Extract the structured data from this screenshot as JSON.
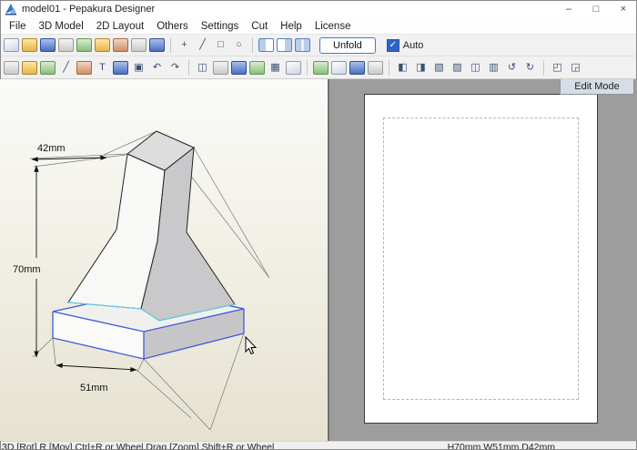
{
  "window": {
    "title": "model01 - Pepakura Designer",
    "controls": {
      "minimize": "–",
      "maximize": "□",
      "close": "×"
    }
  },
  "menu": {
    "items": [
      "File",
      "3D Model",
      "2D Layout",
      "Others",
      "Settings",
      "Cut",
      "Help",
      "License"
    ]
  },
  "toolbar1": {
    "groups": [
      [
        {
          "name": "new-document",
          "style": "ic-a"
        },
        {
          "name": "open-file",
          "style": "ic-b"
        },
        {
          "name": "save-file",
          "style": "ic-c"
        },
        {
          "name": "print",
          "style": "ic-f"
        },
        {
          "name": "texture-settings",
          "style": "ic-d"
        },
        {
          "name": "measure-tool",
          "style": "ic-b"
        },
        {
          "name": "hammer-tool",
          "style": "ic-e"
        },
        {
          "name": "scale-tool",
          "style": "ic-f"
        },
        {
          "name": "link-faces",
          "style": "ic-c"
        }
      ],
      [
        {
          "name": "pick-vertex",
          "glyph": "+"
        },
        {
          "name": "pick-edge",
          "glyph": "╱"
        },
        {
          "name": "pick-face",
          "glyph": "□"
        },
        {
          "name": "pick-object",
          "glyph": "○"
        }
      ],
      [
        {
          "name": "show-3d-window",
          "style": "ic-pane-l"
        },
        {
          "name": "show-2d-window",
          "style": "ic-pane-r"
        },
        {
          "name": "show-both-windows",
          "style": "ic-pane-2"
        }
      ]
    ],
    "unfold_label": "Unfold",
    "auto_label": "Auto",
    "auto_checked": true,
    "check_glyph": "✓"
  },
  "toolbar2": {
    "groups": [
      [
        {
          "name": "move-part",
          "style": "ic-f"
        },
        {
          "name": "divide-edge",
          "style": "ic-b"
        },
        {
          "name": "edit-flaps",
          "style": "ic-d"
        },
        {
          "name": "draw-line",
          "glyph": "╱"
        },
        {
          "name": "eraser",
          "style": "ic-e"
        },
        {
          "name": "text-tool",
          "glyph": "T"
        },
        {
          "name": "image-tool",
          "style": "ic-c"
        },
        {
          "name": "cube-view",
          "glyph": "▣"
        },
        {
          "name": "undo",
          "glyph": "↶"
        },
        {
          "name": "redo",
          "glyph": "↷"
        }
      ],
      [
        {
          "name": "open-book-preview",
          "glyph": "◫"
        },
        {
          "name": "cut-edges",
          "style": "ic-f"
        },
        {
          "name": "join-edges",
          "style": "ic-c"
        },
        {
          "name": "check-parts",
          "style": "ic-d"
        },
        {
          "name": "sheet-grid",
          "glyph": "▦"
        },
        {
          "name": "page-setup",
          "style": "ic-a"
        }
      ],
      [
        {
          "name": "export-image",
          "style": "ic-d"
        },
        {
          "name": "document-info",
          "style": "ic-a"
        },
        {
          "name": "save-2d",
          "style": "ic-c"
        },
        {
          "name": "print-sheets",
          "style": "ic-f"
        }
      ],
      [
        {
          "name": "align-left",
          "glyph": "◧"
        },
        {
          "name": "align-right",
          "glyph": "◨"
        },
        {
          "name": "align-top",
          "glyph": "▧"
        },
        {
          "name": "align-bottom",
          "glyph": "▨"
        },
        {
          "name": "distribute-horizontal",
          "glyph": "◫"
        },
        {
          "name": "distribute-vertical",
          "glyph": "▥"
        },
        {
          "name": "rotate-left",
          "glyph": "↺"
        },
        {
          "name": "rotate-right",
          "glyph": "↻"
        }
      ],
      [
        {
          "name": "zoom-fit",
          "glyph": "◰"
        },
        {
          "name": "arrange-parts",
          "glyph": "◲"
        }
      ]
    ]
  },
  "viewport3d": {
    "dimensions": {
      "top_width": "42mm",
      "height": "70mm",
      "bottom_width": "51mm"
    }
  },
  "viewport2d": {
    "edit_mode_label": "Edit Mode"
  },
  "statusbar": {
    "hint": "3D [Rot] R [Mov] Ctrl+R or Wheel Drag [Zoom] Shift+R or Wheel",
    "model_size": "H70mm W51mm D42mm"
  },
  "colors": {
    "accent": "#2f63c9",
    "edge_selected": "#3f5bd5",
    "edge_cyan": "#63cfe3",
    "pane2d_bg": "#9d9d9d",
    "pane3d_beige": "#e6e2d0"
  }
}
